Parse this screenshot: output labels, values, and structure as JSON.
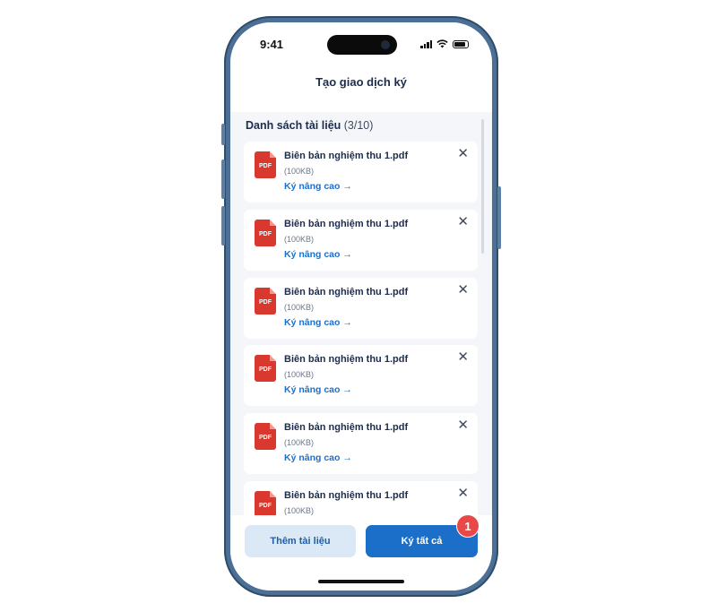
{
  "status_bar": {
    "time": "9:41"
  },
  "header": {
    "title": "Tạo giao dịch ký"
  },
  "list": {
    "title": "Danh sách tài liệu",
    "count": "(3/10)",
    "items": [
      {
        "icon_label": "PDF",
        "name": "Biên bản nghiệm thu 1.pdf",
        "size": "(100KB)",
        "action": "Ký nâng cao →"
      },
      {
        "icon_label": "PDF",
        "name": "Biên bản nghiệm thu 1.pdf",
        "size": "(100KB)",
        "action": "Ký nâng cao →"
      },
      {
        "icon_label": "PDF",
        "name": "Biên bản nghiệm thu 1.pdf",
        "size": "(100KB)",
        "action": "Ký nâng cao →"
      },
      {
        "icon_label": "PDF",
        "name": "Biên bản nghiệm thu 1.pdf",
        "size": "(100KB)",
        "action": "Ký nâng cao →"
      },
      {
        "icon_label": "PDF",
        "name": "Biên bản nghiệm thu 1.pdf",
        "size": "(100KB)",
        "action": "Ký nâng cao →"
      },
      {
        "icon_label": "PDF",
        "name": "Biên bản nghiệm thu 1.pdf",
        "size": "(100KB)",
        "action": ""
      }
    ],
    "close_glyph": "✕"
  },
  "buttons": {
    "add_label": "Thêm tài liệu",
    "sign_all_label": "Ký tất cả"
  },
  "badge": {
    "number": "1"
  },
  "colors": {
    "primary": "#1c6fc9",
    "secondary_bg": "#dbe9f7",
    "pdf_red": "#d9382f",
    "badge_red": "#e74848",
    "phone_frame": "#4b6f95"
  },
  "icons": [
    "signal-icon",
    "wifi-icon",
    "battery-icon",
    "pdf-file-icon",
    "close-icon",
    "arrow-right-icon"
  ]
}
